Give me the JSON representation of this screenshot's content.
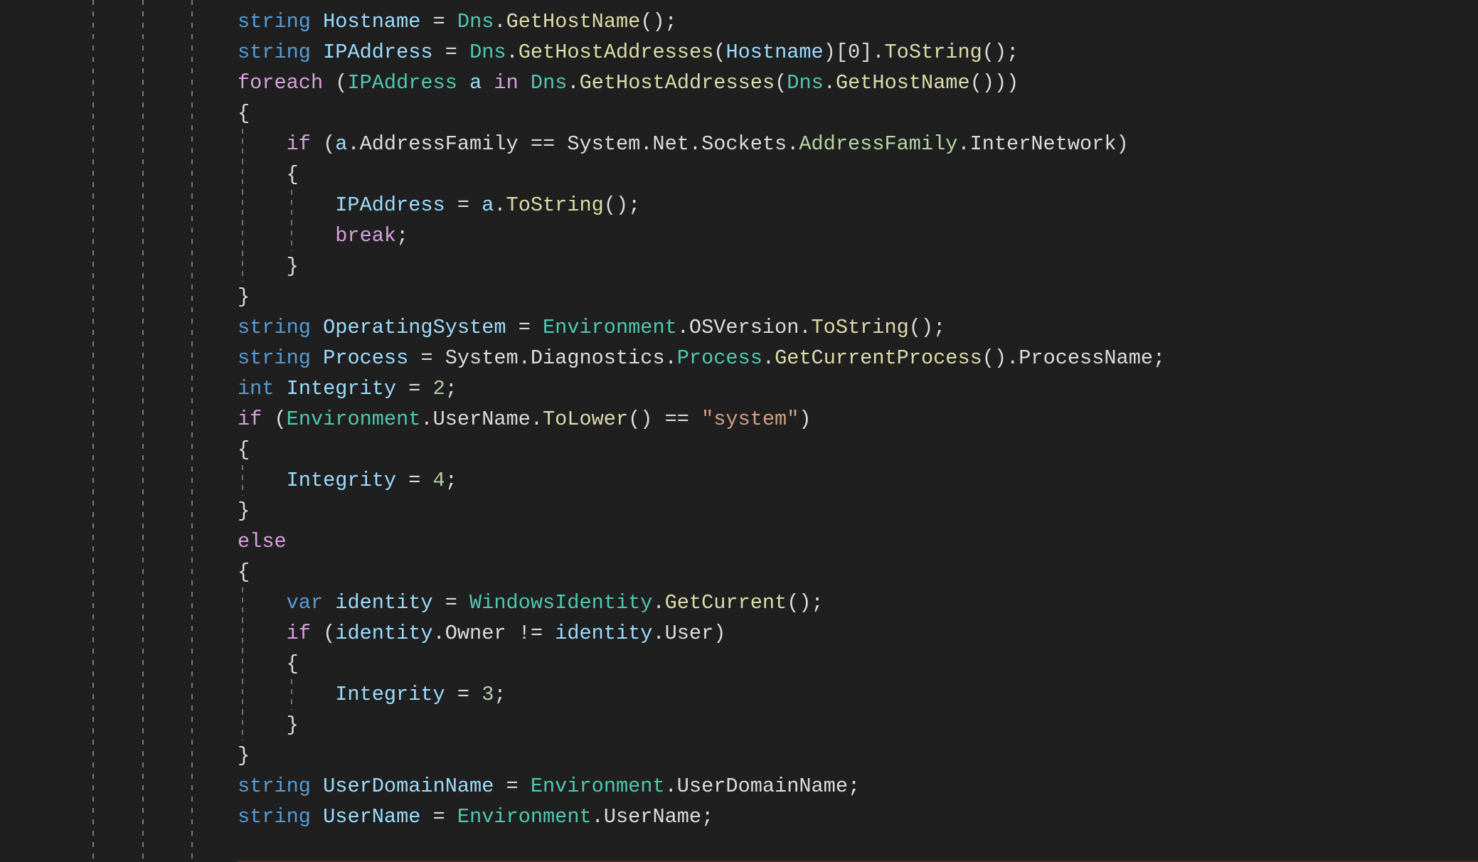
{
  "editor": {
    "language": "C#",
    "colors": {
      "background": "#1f1f1f",
      "keyword": "#569cd6",
      "control": "#d8a0df",
      "type": "#4ec9b0",
      "enum": "#b8d7a3",
      "method": "#dcdcaa",
      "variable": "#9cdcfe",
      "number": "#b5cea8",
      "string": "#d69d85",
      "plain": "#dcdcdc"
    },
    "lines": [
      {
        "indent": 0,
        "tokens": [
          [
            "kw",
            "string"
          ],
          [
            "plain",
            " "
          ],
          [
            "var",
            "Hostname"
          ],
          [
            "plain",
            " = "
          ],
          [
            "type",
            "Dns"
          ],
          [
            "plain",
            "."
          ],
          [
            "method",
            "GetHostName"
          ],
          [
            "plain",
            "();"
          ]
        ]
      },
      {
        "indent": 0,
        "tokens": [
          [
            "kw",
            "string"
          ],
          [
            "plain",
            " "
          ],
          [
            "var",
            "IPAddress"
          ],
          [
            "plain",
            " = "
          ],
          [
            "type",
            "Dns"
          ],
          [
            "plain",
            "."
          ],
          [
            "method",
            "GetHostAddresses"
          ],
          [
            "plain",
            "("
          ],
          [
            "var",
            "Hostname"
          ],
          [
            "plain",
            ")[0]."
          ],
          [
            "method",
            "ToString"
          ],
          [
            "plain",
            "();"
          ]
        ]
      },
      {
        "indent": 0,
        "tokens": [
          [
            "ctl",
            "foreach"
          ],
          [
            "plain",
            " ("
          ],
          [
            "type",
            "IPAddress"
          ],
          [
            "plain",
            " "
          ],
          [
            "var",
            "a"
          ],
          [
            "plain",
            " "
          ],
          [
            "ctl",
            "in"
          ],
          [
            "plain",
            " "
          ],
          [
            "type",
            "Dns"
          ],
          [
            "plain",
            "."
          ],
          [
            "method",
            "GetHostAddresses"
          ],
          [
            "plain",
            "("
          ],
          [
            "type",
            "Dns"
          ],
          [
            "plain",
            "."
          ],
          [
            "method",
            "GetHostName"
          ],
          [
            "plain",
            "()))"
          ]
        ]
      },
      {
        "indent": 0,
        "tokens": [
          [
            "plain",
            "{"
          ]
        ]
      },
      {
        "indent": 1,
        "tokens": [
          [
            "ctl",
            "if"
          ],
          [
            "plain",
            " ("
          ],
          [
            "var",
            "a"
          ],
          [
            "plain",
            ".AddressFamily == System.Net.Sockets."
          ],
          [
            "enum",
            "AddressFamily"
          ],
          [
            "plain",
            ".InterNetwork)"
          ]
        ]
      },
      {
        "indent": 1,
        "tokens": [
          [
            "plain",
            "{"
          ]
        ]
      },
      {
        "indent": 2,
        "tokens": [
          [
            "var",
            "IPAddress"
          ],
          [
            "plain",
            " = "
          ],
          [
            "var",
            "a"
          ],
          [
            "plain",
            "."
          ],
          [
            "method",
            "ToString"
          ],
          [
            "plain",
            "();"
          ]
        ]
      },
      {
        "indent": 2,
        "tokens": [
          [
            "ctl",
            "break"
          ],
          [
            "plain",
            ";"
          ]
        ]
      },
      {
        "indent": 1,
        "tokens": [
          [
            "plain",
            "}"
          ]
        ]
      },
      {
        "indent": 0,
        "tokens": [
          [
            "plain",
            "}"
          ]
        ]
      },
      {
        "indent": 0,
        "tokens": [
          [
            "kw",
            "string"
          ],
          [
            "plain",
            " "
          ],
          [
            "var",
            "OperatingSystem"
          ],
          [
            "plain",
            " = "
          ],
          [
            "type",
            "Environment"
          ],
          [
            "plain",
            ".OSVersion."
          ],
          [
            "method",
            "ToString"
          ],
          [
            "plain",
            "();"
          ]
        ]
      },
      {
        "indent": 0,
        "tokens": [
          [
            "kw",
            "string"
          ],
          [
            "plain",
            " "
          ],
          [
            "var",
            "Process"
          ],
          [
            "plain",
            " = System.Diagnostics."
          ],
          [
            "type",
            "Process"
          ],
          [
            "plain",
            "."
          ],
          [
            "method",
            "GetCurrentProcess"
          ],
          [
            "plain",
            "().ProcessName;"
          ]
        ]
      },
      {
        "indent": 0,
        "tokens": [
          [
            "kw",
            "int"
          ],
          [
            "plain",
            " "
          ],
          [
            "var",
            "Integrity"
          ],
          [
            "plain",
            " = "
          ],
          [
            "num",
            "2"
          ],
          [
            "plain",
            ";"
          ]
        ]
      },
      {
        "indent": 0,
        "tokens": [
          [
            "ctl",
            "if"
          ],
          [
            "plain",
            " ("
          ],
          [
            "type",
            "Environment"
          ],
          [
            "plain",
            ".UserName."
          ],
          [
            "method",
            "ToLower"
          ],
          [
            "plain",
            "() == "
          ],
          [
            "str",
            "\"system\""
          ],
          [
            "plain",
            ")"
          ]
        ]
      },
      {
        "indent": 0,
        "tokens": [
          [
            "plain",
            "{"
          ]
        ]
      },
      {
        "indent": 1,
        "tokens": [
          [
            "var",
            "Integrity"
          ],
          [
            "plain",
            " = "
          ],
          [
            "num",
            "4"
          ],
          [
            "plain",
            ";"
          ]
        ]
      },
      {
        "indent": 0,
        "tokens": [
          [
            "plain",
            "}"
          ]
        ]
      },
      {
        "indent": 0,
        "tokens": [
          [
            "ctl",
            "else"
          ]
        ]
      },
      {
        "indent": 0,
        "tokens": [
          [
            "plain",
            "{"
          ]
        ]
      },
      {
        "indent": 1,
        "tokens": [
          [
            "kw",
            "var"
          ],
          [
            "plain",
            " "
          ],
          [
            "var",
            "identity"
          ],
          [
            "plain",
            " = "
          ],
          [
            "type",
            "WindowsIdentity"
          ],
          [
            "plain",
            "."
          ],
          [
            "method",
            "GetCurrent"
          ],
          [
            "plain",
            "();"
          ]
        ]
      },
      {
        "indent": 1,
        "tokens": [
          [
            "ctl",
            "if"
          ],
          [
            "plain",
            " ("
          ],
          [
            "var",
            "identity"
          ],
          [
            "plain",
            ".Owner != "
          ],
          [
            "var",
            "identity"
          ],
          [
            "plain",
            ".User)"
          ]
        ]
      },
      {
        "indent": 1,
        "tokens": [
          [
            "plain",
            "{"
          ]
        ]
      },
      {
        "indent": 2,
        "tokens": [
          [
            "var",
            "Integrity"
          ],
          [
            "plain",
            " = "
          ],
          [
            "num",
            "3"
          ],
          [
            "plain",
            ";"
          ]
        ]
      },
      {
        "indent": 1,
        "tokens": [
          [
            "plain",
            "}"
          ]
        ]
      },
      {
        "indent": 0,
        "tokens": [
          [
            "plain",
            "}"
          ]
        ]
      },
      {
        "indent": 0,
        "tokens": [
          [
            "kw",
            "string"
          ],
          [
            "plain",
            " "
          ],
          [
            "var",
            "UserDomainName"
          ],
          [
            "plain",
            " = "
          ],
          [
            "type",
            "Environment"
          ],
          [
            "plain",
            ".UserDomainName;"
          ]
        ]
      },
      {
        "indent": 0,
        "tokens": [
          [
            "kw",
            "string"
          ],
          [
            "plain",
            " "
          ],
          [
            "var",
            "UserName"
          ],
          [
            "plain",
            " = "
          ],
          [
            "type",
            "Environment"
          ],
          [
            "plain",
            ".UserName;"
          ]
        ]
      }
    ]
  }
}
